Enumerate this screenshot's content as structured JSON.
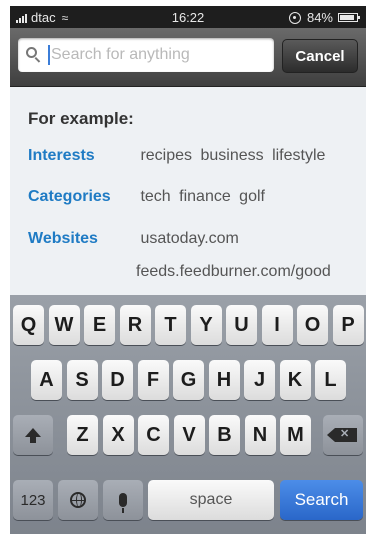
{
  "status_bar": {
    "carrier": "dtac",
    "time": "16:22",
    "battery": "84%"
  },
  "search": {
    "placeholder": "Search for anything",
    "value": "",
    "cancel_label": "Cancel"
  },
  "examples": {
    "heading": "For example:",
    "interests": {
      "label": "Interests",
      "items": "recipes business lifestyle"
    },
    "categories": {
      "label": "Categories",
      "items": "tech finance golf"
    },
    "websites": {
      "label": "Websites",
      "line1": "usatoday.com",
      "line2": "feeds.feedburner.com/good"
    }
  },
  "keyboard": {
    "row1": [
      "Q",
      "W",
      "E",
      "R",
      "T",
      "Y",
      "U",
      "I",
      "O",
      "P"
    ],
    "row2": [
      "A",
      "S",
      "D",
      "F",
      "G",
      "H",
      "J",
      "K",
      "L"
    ],
    "row3": [
      "Z",
      "X",
      "C",
      "V",
      "B",
      "N",
      "M"
    ],
    "num_label": "123",
    "space_label": "space",
    "search_label": "Search"
  },
  "colors": {
    "link_blue": "#1f7bc4",
    "search_key_blue": "#2a67c9"
  }
}
